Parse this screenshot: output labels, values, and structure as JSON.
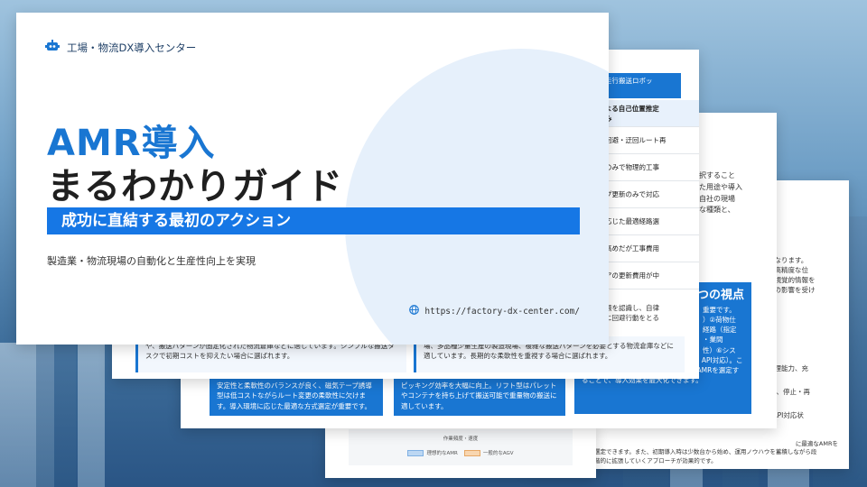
{
  "brand": {
    "name": "工場・物流DX導入センター",
    "icon": "robot-icon"
  },
  "cover": {
    "title_line1": "AMR導入",
    "title_line2": "まるわかりガイド",
    "band_text": "成功に直結する最初のアクション",
    "subtitle": "製造業・物流現場の自動化と生産性向上を実現",
    "url": "https://factory-dx-center.com/"
  },
  "slide_table": {
    "header": "走行搬送ロボッ",
    "rows": [
      "よる自己位置推定\nみ",
      "回避・迂回ルート再",
      "のみで物理的工事",
      "プ更新のみで対応",
      "応じた最適経路選",
      "高めだが工事費用",
      "アの更新費用が中"
    ]
  },
  "slide_four_views": {
    "text_top": [
      "選択すること",
      "した用途や導入",
      "、自社の現場",
      "主な種類と、"
    ],
    "box_title": "つの視点",
    "box_lines": [
      "重要です。",
      "）②荷物仕",
      "経路（指定",
      "・業間",
      "性）⑥シス"
    ]
  },
  "slide_right": {
    "lines": [
      "重なります。",
      "は高精度な位",
      "る視覚的情報を",
      "路の影響を受け"
    ],
    "items": [
      "処理能力、充",
      "止、停止・再",
      "、API対応状"
    ],
    "footer": [
      "に最適なAMRを",
      "選定できます。また、初期導入時は少数台から始め、運用ノウハウを蓄積しながら段",
      "階的に拡張していくアプローチが効果的です。"
    ]
  },
  "slide_mid_text": {
    "text": [
      "環を認識し、自律",
      "に回避行動をとる"
    ],
    "box_tail": [
      "テム連携（既存WMS/ERPとの接続性・API対応）。こ",
      "れらを総合的に評価し、現場に最適なAMRを選定す",
      "ることで、導入効果を最大化できます。"
    ]
  },
  "quote_left": "や、搬送パターンが固定化された物流倉庫などに適しています。シンプルな搬送タスクで初期コストを抑えたい場合に選ばれます。",
  "quote_mid": "場、多品種少量生産の製造現場、複雑な搬送パターンを必要とする物流倉庫などに適しています。長期的な柔軟性を重視する場合に選ばれます。",
  "box_left": "安定性と柔軟性のバランスが良く、磁気テープ誘導型は低コストながらルート変更の柔軟性に欠けます。導入環境に応じた最適な方式選定が重要です。",
  "box_mid": "ピッキング効率を大幅に向上。リフト型はパレットやコンテナを持ち上げて搬送可能で重量物の搬送に適しています。",
  "chart_legend": {
    "title": "作業頻度・速度",
    "items": [
      "理想的なAMR",
      "一般的なAGV"
    ]
  },
  "colors": {
    "accent": "#1976d2",
    "band": "#1677e5",
    "legend_blue": "#bcd7f3",
    "legend_orange": "#f8d6b0"
  }
}
